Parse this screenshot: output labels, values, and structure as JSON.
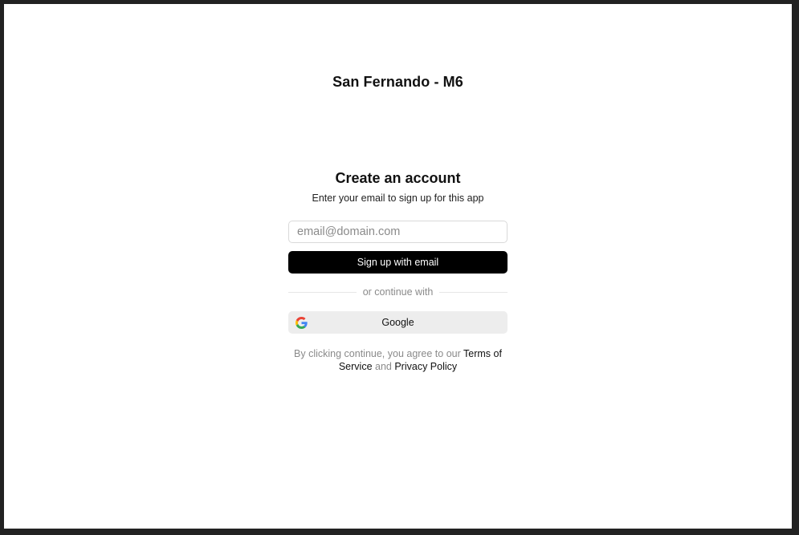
{
  "app": {
    "title": "San Fernando - M6"
  },
  "signup": {
    "heading": "Create an account",
    "subheading": "Enter your email to sign up for this app",
    "email_placeholder": "email@domain.com",
    "email_value": "",
    "submit_label": "Sign up with email",
    "divider_text": "or continue with",
    "google_label": "Google",
    "google_icon": "google-icon"
  },
  "legal": {
    "prefix": "By clicking continue, you agree to our ",
    "terms_link": "Terms of Service",
    "conjunction": " and ",
    "privacy_link": "Privacy Policy"
  },
  "colors": {
    "primary_button": "#000000",
    "secondary_button": "#ededed",
    "muted_text": "#8a8a8a"
  }
}
